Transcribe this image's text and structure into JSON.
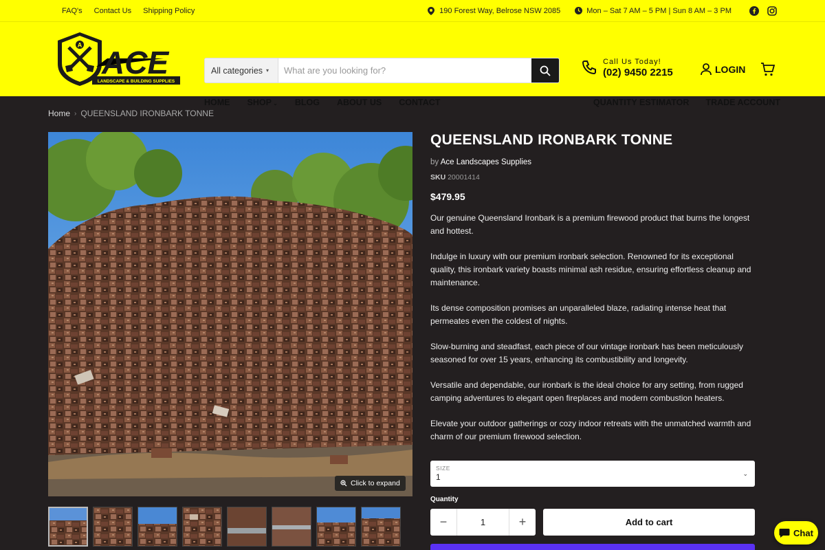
{
  "utility": {
    "links": [
      "FAQ's",
      "Contact Us",
      "Shipping Policy"
    ],
    "address": "190 Forest Way, Belrose NSW 2085",
    "hours": "Mon – Sat 7 AM – 5 PM | Sun 8 AM – 3 PM",
    "social": [
      "facebook-icon",
      "instagram-icon"
    ]
  },
  "brand": {
    "name": "ACE",
    "tagline": "LANDSCAPE & BUILDING SUPPLIES",
    "colors": {
      "yellow": "#ffff00",
      "dark": "#231f20",
      "black": "#1a1a1a",
      "shop_pay": "#5a31f4"
    }
  },
  "search": {
    "category": "All categories",
    "placeholder": "What are you looking for?"
  },
  "contact": {
    "label": "Call Us Today!",
    "phone": "(02) 9450 2215"
  },
  "account": {
    "login": "LOGIN"
  },
  "nav": {
    "main": [
      "HOME",
      "SHOP",
      "BLOG",
      "ABOUT US",
      "CONTACT"
    ],
    "right": [
      "QUANTITY ESTIMATOR",
      "TRADE ACCOUNT"
    ]
  },
  "breadcrumb": {
    "home": "Home",
    "current": "QUEENSLAND IRONBARK TONNE"
  },
  "product": {
    "title": "QUEENSLAND IRONBARK TONNE",
    "by": "by",
    "vendor": "Ace Landscapes Supplies",
    "sku_label": "SKU",
    "sku": "20001414",
    "price": "$479.95",
    "description": [
      "Our genuine Queensland Ironbark is a premium firewood product that burns the longest and hottest.",
      "Indulge in luxury with our premium ironbark selection. Renowned for its exceptional quality, this ironbark variety boasts minimal ash residue, ensuring effortless cleanup and maintenance.",
      "Its dense composition promises an unparalleled blaze, radiating intense heat that permeates even the coldest of nights.",
      "Slow-burning and steadfast, each piece of our vintage ironbark has been meticulously seasoned for over 15 years, enhancing its combustibility and longevity.",
      "Versatile and dependable, our ironbark is the ideal choice for any setting, from rugged camping adventures to elegant open fireplaces and modern combustion heaters.",
      "Elevate your outdoor gatherings or cozy indoor retreats with the unmatched warmth and charm of our premium firewood selection."
    ],
    "size_label": "SIZE",
    "size_value": "1",
    "quantity_label": "Quantity",
    "quantity": "1",
    "add_to_cart": "Add to cart",
    "expand": "Click to expand"
  },
  "chat": {
    "label": "Chat"
  }
}
